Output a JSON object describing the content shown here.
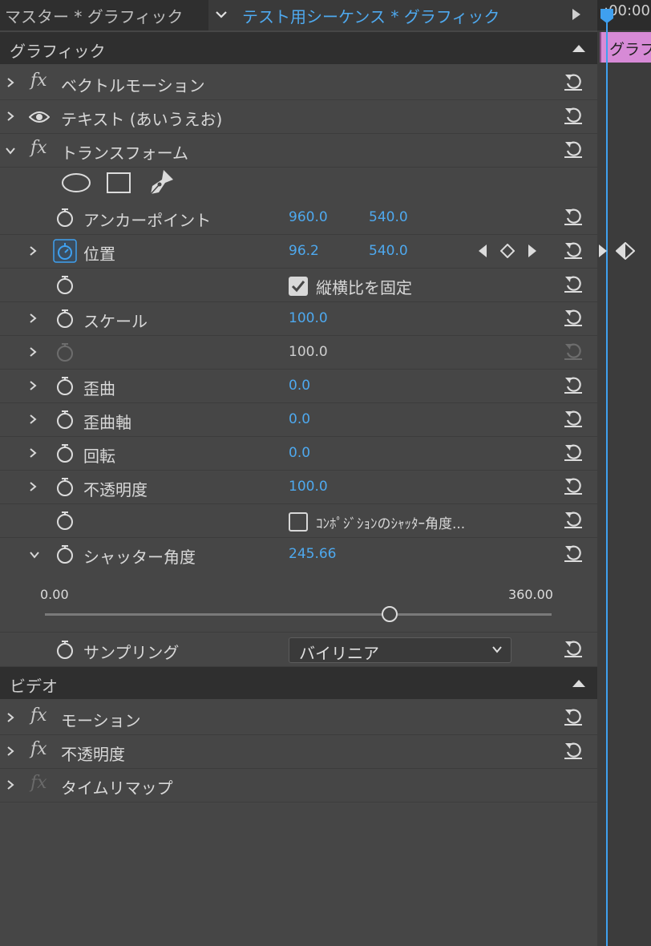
{
  "header": {
    "master_label": "マスター * グラフィック",
    "sequence_label": "テスト用シーケンス * グラフィック",
    "timecode": ":00:00",
    "clip_label": "グラフ"
  },
  "sections": {
    "graphics_title": "グラフィック",
    "video_title": "ビデオ"
  },
  "graphics_effects": {
    "vector_motion": "ベクトルモーション",
    "text_layer": "テキスト (あいうえお)",
    "transform": "トランスフォーム"
  },
  "transform": {
    "anchor_label": "アンカーポイント",
    "anchor_x": "960.0",
    "anchor_y": "540.0",
    "position_label": "位置",
    "position_x": "96.2",
    "position_y": "540.0",
    "lock_aspect_label": "縦横比を固定",
    "scale_label": "スケール",
    "scale_value": "100.0",
    "scale_width_value": "100.0",
    "skew_label": "歪曲",
    "skew_value": "0.0",
    "skew_axis_label": "歪曲軸",
    "skew_axis_value": "0.0",
    "rotation_label": "回転",
    "rotation_value": "0.0",
    "opacity_label": "不透明度",
    "opacity_value": "100.0",
    "comp_shutter_label": "ｺﾝﾎﾟｼﾞｼｮﾝのｼｬｯﾀｰ角度...",
    "shutter_label": "シャッター角度",
    "shutter_value": "245.66",
    "slider_min": "0.00",
    "slider_max": "360.00",
    "slider_fraction": 0.68,
    "sampling_label": "サンプリング",
    "sampling_value": "バイリニア"
  },
  "video_effects": {
    "motion": "モーション",
    "opacity": "不透明度",
    "time_remap": "タイムリマップ"
  },
  "colors": {
    "accent_blue": "#4ea9ef",
    "clip_pink": "#d78ad6",
    "panel_bg": "#464646"
  }
}
